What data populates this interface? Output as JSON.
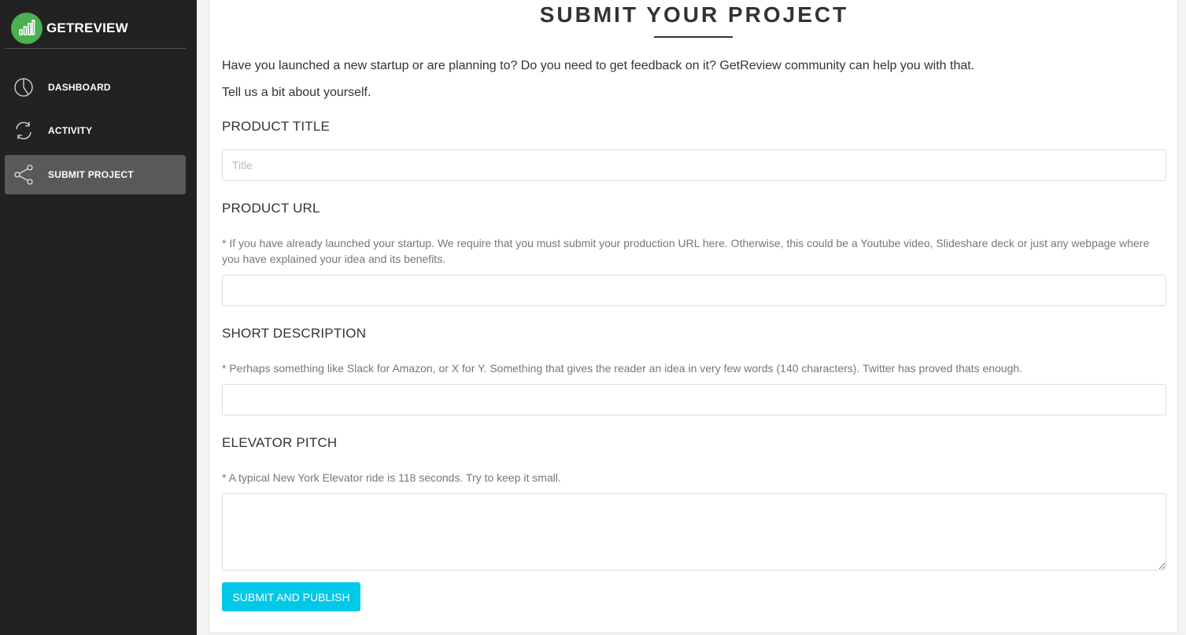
{
  "brand": {
    "name": "GETREVIEW",
    "logo_icon": "bar-chart-icon",
    "logo_color": "#4caf50"
  },
  "sidebar": {
    "items": [
      {
        "label": "DASHBOARD",
        "icon": "pie-chart-icon",
        "active": false
      },
      {
        "label": "ACTIVITY",
        "icon": "refresh-icon",
        "active": false
      },
      {
        "label": "SUBMIT PROJECT",
        "icon": "share-icon",
        "active": true
      }
    ]
  },
  "main": {
    "title": "SUBMIT YOUR PROJECT",
    "intro": "Have you launched a new startup or are planning to? Do you need to get feedback on it? GetReview community can help you with that.",
    "intro2": "Tell us a bit about yourself.",
    "fields": [
      {
        "label": "PRODUCT TITLE",
        "help": "",
        "placeholder": "Title",
        "value": ""
      },
      {
        "label": "PRODUCT URL",
        "help": "* If you have already launched your startup. We require that you must submit your production URL here. Otherwise, this could be a Youtube video, Slideshare deck or just any webpage where you have explained your idea and its benefits.",
        "placeholder": "",
        "value": ""
      },
      {
        "label": "SHORT DESCRIPTION",
        "help": "* Perhaps something like Slack for Amazon, or X for Y. Something that gives the reader an idea in very few words (140 characters). Twitter has proved thats enough.",
        "placeholder": "",
        "value": ""
      },
      {
        "label": "ELEVATOR PITCH",
        "help": "* A typical New York Elevator ride is 118 seconds. Try to keep it small.",
        "placeholder": "",
        "value": ""
      }
    ],
    "submit_label": "SUBMIT AND PUBLISH"
  },
  "colors": {
    "sidebar_bg": "#222222",
    "active_item_bg": "#595959",
    "button": "#00c8e6"
  }
}
